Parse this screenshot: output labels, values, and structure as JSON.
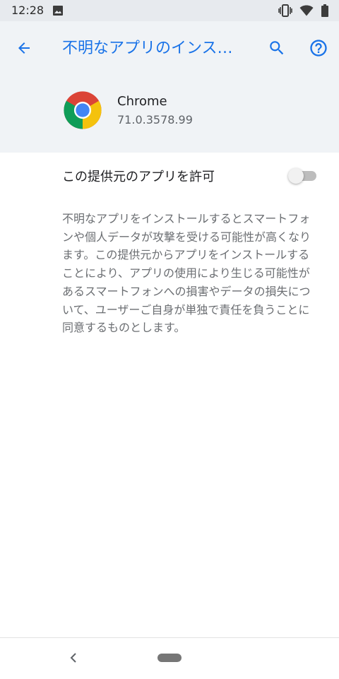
{
  "status_bar": {
    "time": "12:28",
    "icons": [
      "image-icon",
      "vibrate-icon",
      "wifi-icon",
      "battery-icon"
    ]
  },
  "toolbar": {
    "title": "不明なアプリのインス…",
    "back_icon": "arrow-back-icon",
    "search_icon": "search-icon",
    "help_icon": "help-icon"
  },
  "app": {
    "name": "Chrome",
    "version": "71.0.3578.99",
    "icon": "chrome-icon"
  },
  "preference": {
    "label": "この提供元のアプリを許可",
    "enabled": false
  },
  "description": "不明なアプリをインストールするとスマートフォンや個人データが攻撃を受ける可能性が高くなります。この提供元からアプリをインストールすることにより、アプリの使用により生じる可能性があるスマートフォンへの損害やデータの損失について、ユーザーご自身が単独で責任を負うことに同意するものとします。",
  "colors": {
    "accent": "#1a73e8",
    "header_bg": "#f0f3f6",
    "status_bg": "#e7eaee"
  }
}
